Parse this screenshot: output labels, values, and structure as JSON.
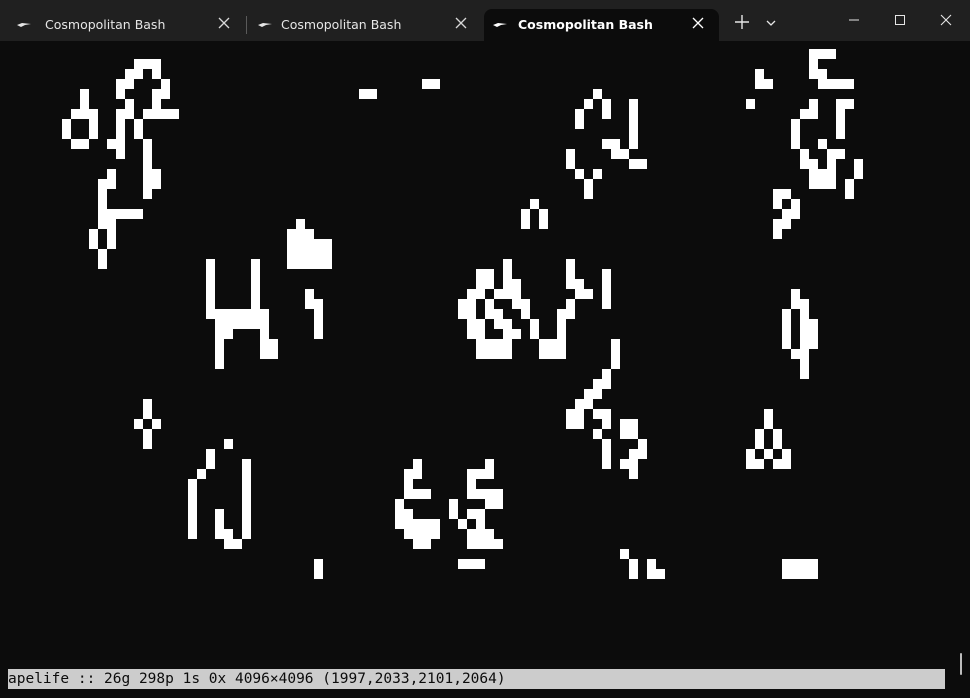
{
  "tabs": [
    {
      "label": "Cosmopolitan Bash",
      "active": false
    },
    {
      "label": "Cosmopolitan Bash",
      "active": false
    },
    {
      "label": "Cosmopolitan Bash",
      "active": true
    }
  ],
  "icons": {
    "tab": "terminal-icon",
    "tab_close": "close-icon",
    "new_tab": "plus-icon",
    "dropdown": "chevron-down-icon",
    "minimize": "minimize-icon",
    "maximize": "maximize-icon",
    "close": "close-icon"
  },
  "colors": {
    "titlebar": "#202020",
    "terminal_bg": "#0c0c0c",
    "cell": "#ffffff",
    "statusbar_bg": "#cccccc",
    "statusbar_fg": "#0c0c0c"
  },
  "status": {
    "text": "apelife :: 26g 298p 1s 0x 4096×4096 (1997,2033,2101,2064)"
  }
}
